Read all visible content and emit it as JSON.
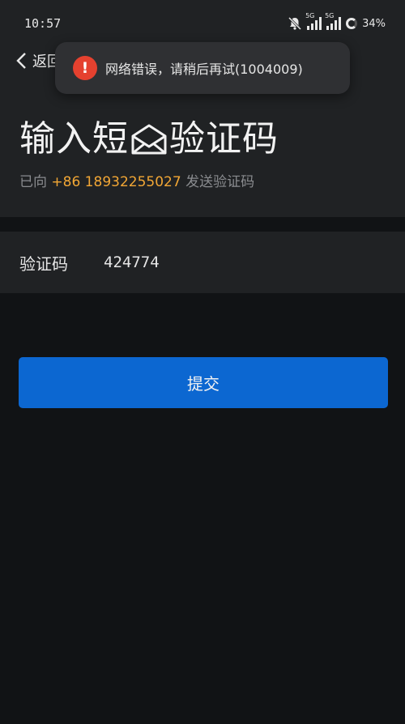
{
  "status_bar": {
    "time": "10:57",
    "signal_1_label": "5G",
    "signal_2_label": "5G",
    "battery": "34%"
  },
  "nav": {
    "back_label": "返回"
  },
  "toast": {
    "icon": "!",
    "message": "网络错误，请稍后再试(1004009)"
  },
  "header": {
    "title_before": "输入短",
    "title_after": "验证码",
    "subtitle_prefix": "已向",
    "phone": "+86 18932255027",
    "subtitle_suffix": "发送验证码"
  },
  "form": {
    "code_label": "验证码",
    "code_value": "424774"
  },
  "submit_label": "提交",
  "colors": {
    "accent": "#0c67d1",
    "phone_highlight": "#f2a735",
    "error": "#e5412f"
  }
}
